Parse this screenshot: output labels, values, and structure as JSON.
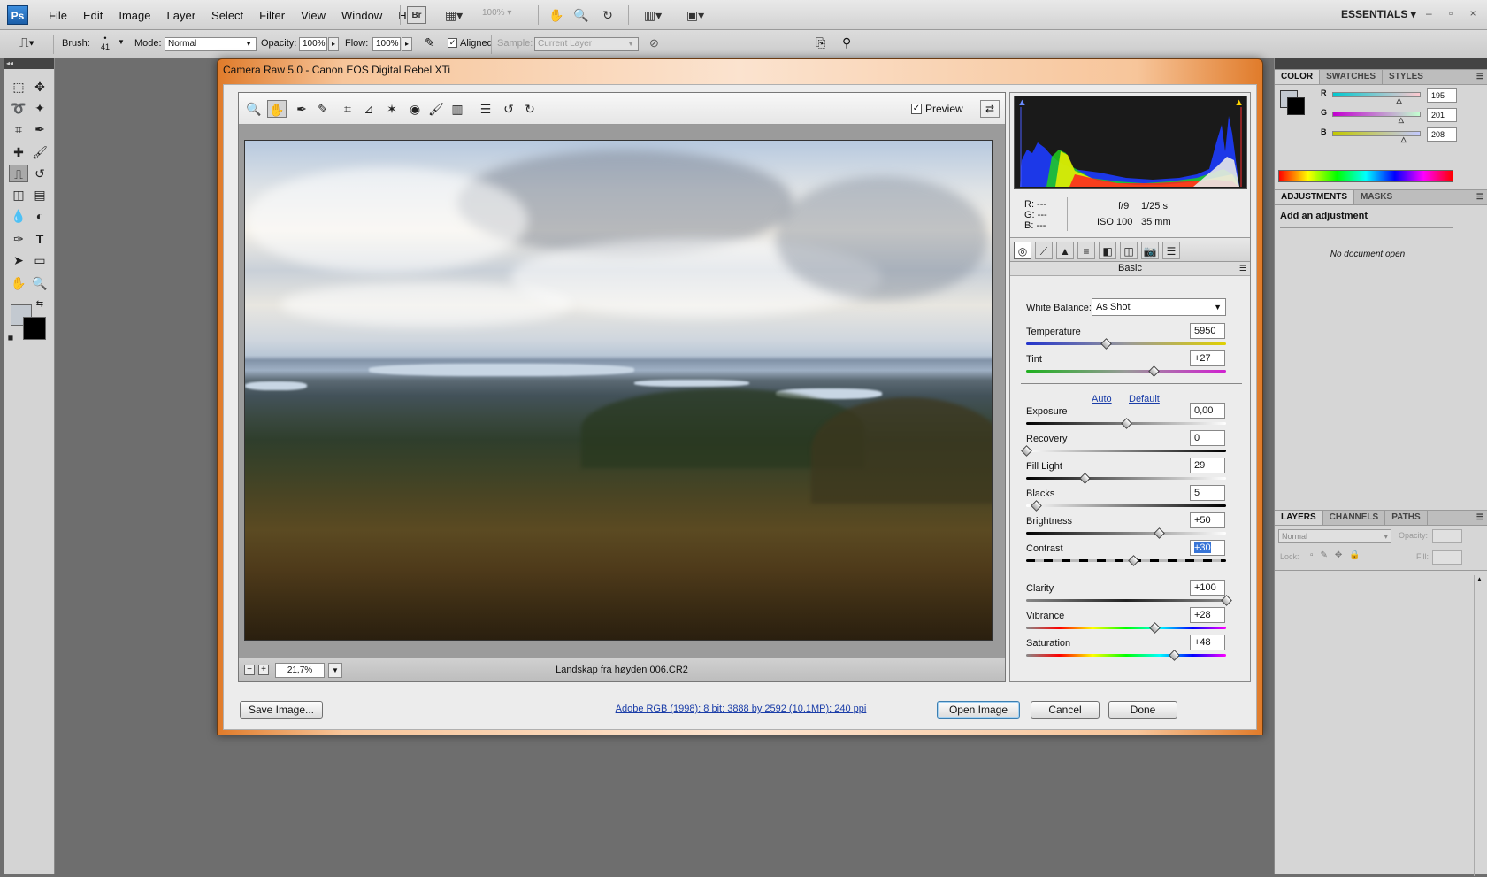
{
  "app": {
    "logo": "Ps",
    "menus": [
      "File",
      "Edit",
      "Image",
      "Layer",
      "Select",
      "Filter",
      "View",
      "Window",
      "Help"
    ],
    "bridge_label": "Br",
    "zoom_combo": "100%",
    "workspace": "ESSENTIALS",
    "window_controls": "– ▫ ×"
  },
  "options_bar": {
    "brush_label": "Brush:",
    "brush_size": "41",
    "mode_label": "Mode:",
    "mode_value": "Normal",
    "opacity_label": "Opacity:",
    "opacity_value": "100%",
    "flow_label": "Flow:",
    "flow_value": "100%",
    "aligned_label": "Aligned",
    "sample_label": "Sample:",
    "sample_value": "Current Layer"
  },
  "color_panel": {
    "tabs": [
      "COLOR",
      "SWATCHES",
      "STYLES"
    ],
    "channels": [
      {
        "label": "R",
        "value": "195",
        "fraction": 0.765
      },
      {
        "label": "G",
        "value": "201",
        "fraction": 0.788
      },
      {
        "label": "B",
        "value": "208",
        "fraction": 0.816
      }
    ]
  },
  "adjustments_panel": {
    "tabs": [
      "ADJUSTMENTS",
      "MASKS"
    ],
    "heading": "Add an adjustment",
    "empty_text": "No document open"
  },
  "layers_panel": {
    "tabs": [
      "LAYERS",
      "CHANNELS",
      "PATHS"
    ],
    "blend_mode": "Normal",
    "opacity_label": "Opacity:",
    "lock_label": "Lock:",
    "fill_label": "Fill:"
  },
  "dialog": {
    "title": "Camera Raw 5.0  -  Canon EOS Digital Rebel XTi",
    "preview_label": "Preview",
    "preview_checked": true,
    "zoom": "21,7%",
    "filename": "Landskap fra høyden 006.CR2",
    "workflow": "Adobe RGB (1998); 8 bit; 3888 by 2592 (10,1MP); 240 ppi",
    "buttons": {
      "save": "Save Image...",
      "open": "Open Image",
      "cancel": "Cancel",
      "done": "Done"
    },
    "info": {
      "r": "R:   ---",
      "g": "G:   ---",
      "b": "B:   ---",
      "aperture": "f/9",
      "shutter": "1/25 s",
      "iso": "ISO 100",
      "focal": "35 mm"
    },
    "panel_title": "Basic",
    "white_balance_label": "White Balance:",
    "white_balance_value": "As Shot",
    "auto_label": "Auto",
    "default_label": "Default",
    "sliders": [
      {
        "name": "temperature",
        "label": "Temperature",
        "value": "5950",
        "fraction": 0.4
      },
      {
        "name": "tint",
        "label": "Tint",
        "value": "+27",
        "fraction": 0.635
      },
      {
        "name": "exposure",
        "label": "Exposure",
        "value": "0,00",
        "fraction": 0.5
      },
      {
        "name": "recovery",
        "label": "Recovery",
        "value": "0",
        "fraction": 0.0
      },
      {
        "name": "fill-light",
        "label": "Fill Light",
        "value": "29",
        "fraction": 0.29
      },
      {
        "name": "blacks",
        "label": "Blacks",
        "value": "5",
        "fraction": 0.05
      },
      {
        "name": "brightness",
        "label": "Brightness",
        "value": "+50",
        "fraction": 0.665
      },
      {
        "name": "contrast",
        "label": "Contrast",
        "value": "+30",
        "fraction": 0.535
      },
      {
        "name": "clarity",
        "label": "Clarity",
        "value": "+100",
        "fraction": 1.0
      },
      {
        "name": "vibrance",
        "label": "Vibrance",
        "value": "+28",
        "fraction": 0.64
      },
      {
        "name": "saturation",
        "label": "Saturation",
        "value": "+48",
        "fraction": 0.74
      }
    ]
  },
  "colors": {
    "accent": "#e07b2a",
    "selection": "#3875d7",
    "link": "#1a3da8"
  }
}
